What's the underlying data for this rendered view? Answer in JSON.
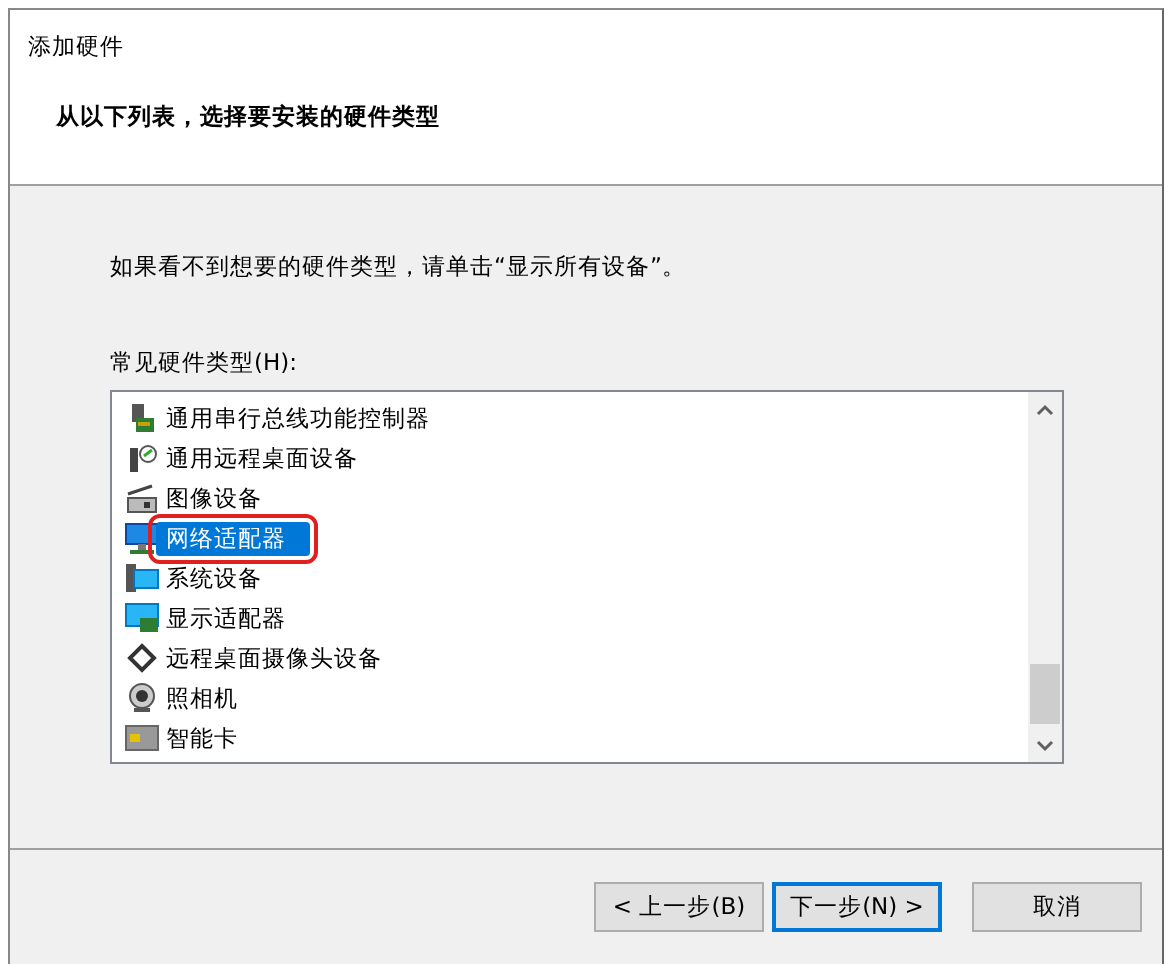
{
  "window": {
    "title": "添加硬件"
  },
  "header": {
    "subtitle": "从以下列表，选择要安装的硬件类型"
  },
  "body": {
    "hint": "如果看不到想要的硬件类型，请单击“显示所有设备”。",
    "list_label": "常见硬件类型(H):"
  },
  "list": {
    "items": [
      {
        "kind": "usb",
        "label": "通用串行总线功能控制器",
        "selected": false,
        "marked": false
      },
      {
        "kind": "remote",
        "label": "通用远程桌面设备",
        "selected": false,
        "marked": false
      },
      {
        "kind": "scanner",
        "label": "图像设备",
        "selected": false,
        "marked": false
      },
      {
        "kind": "network",
        "label": "网络适配器",
        "selected": true,
        "marked": true
      },
      {
        "kind": "system",
        "label": "系统设备",
        "selected": false,
        "marked": false
      },
      {
        "kind": "display",
        "label": "显示适配器",
        "selected": false,
        "marked": false
      },
      {
        "kind": "camera-remote",
        "label": "远程桌面摄像头设备",
        "selected": false,
        "marked": false
      },
      {
        "kind": "webcam",
        "label": "照相机",
        "selected": false,
        "marked": false
      },
      {
        "kind": "smartcard",
        "label": "智能卡",
        "selected": false,
        "marked": false
      }
    ]
  },
  "buttons": [
    {
      "label": "< 上一步(B)",
      "default": false
    },
    {
      "label": "下一步(N) >",
      "default": true
    },
    {
      "label": "取消",
      "default": false
    }
  ]
}
